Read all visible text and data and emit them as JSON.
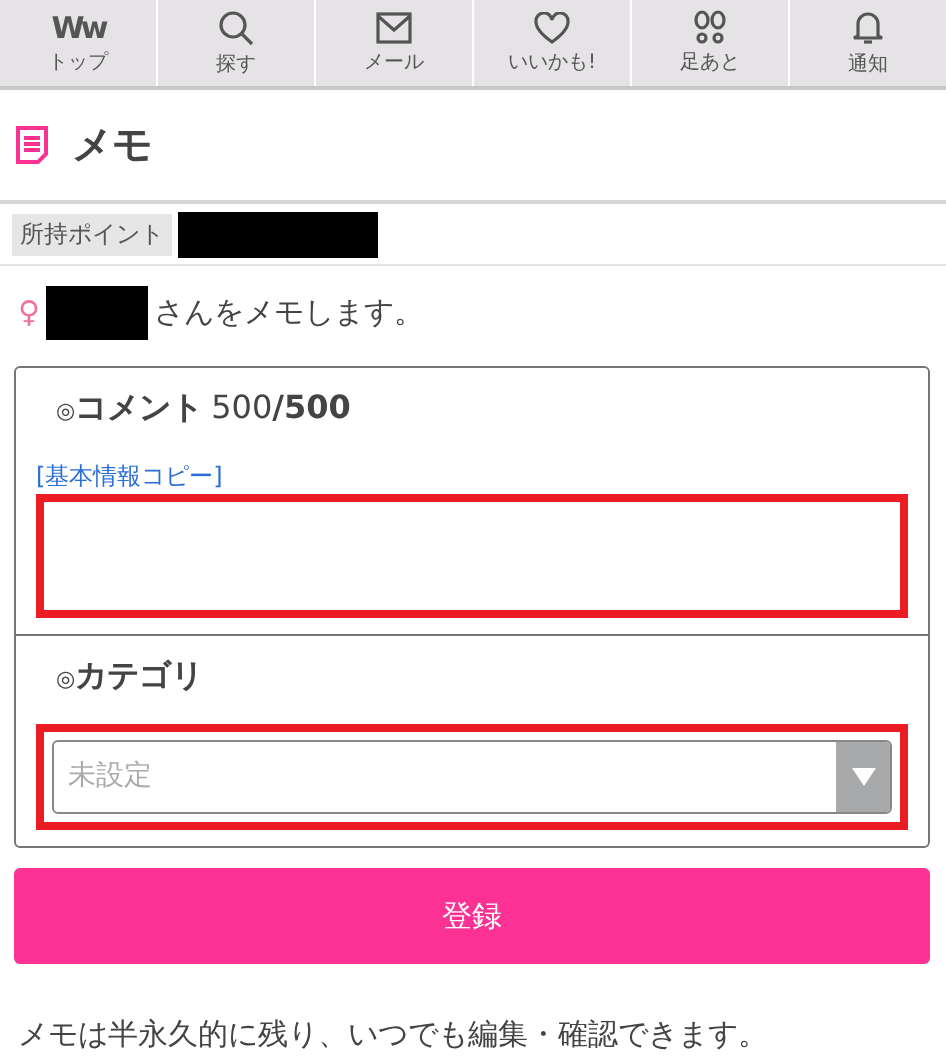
{
  "nav": [
    {
      "kind": "logo",
      "logo": "Ww",
      "label": "トップ"
    },
    {
      "kind": "search",
      "label": "探す"
    },
    {
      "kind": "mail",
      "label": "メール"
    },
    {
      "kind": "heart",
      "label": "いいかも!"
    },
    {
      "kind": "footprints",
      "label": "足あと"
    },
    {
      "kind": "bell",
      "label": "通知"
    }
  ],
  "title": "メモ",
  "points": {
    "label": "所持ポイント"
  },
  "target": {
    "mark": "♀",
    "text": "さんをメモします。"
  },
  "comment": {
    "mark": "◎",
    "label": "コメント",
    "count": "500",
    "max": "/500",
    "copy_link": "[基本情報コピー]",
    "highlighted": true
  },
  "category": {
    "mark": "◎",
    "label": "カテゴリ",
    "placeholder": "未設定",
    "highlighted": true
  },
  "submit": "登録",
  "note": "メモは半永久的に残り、いつでも編集・確認できます。"
}
